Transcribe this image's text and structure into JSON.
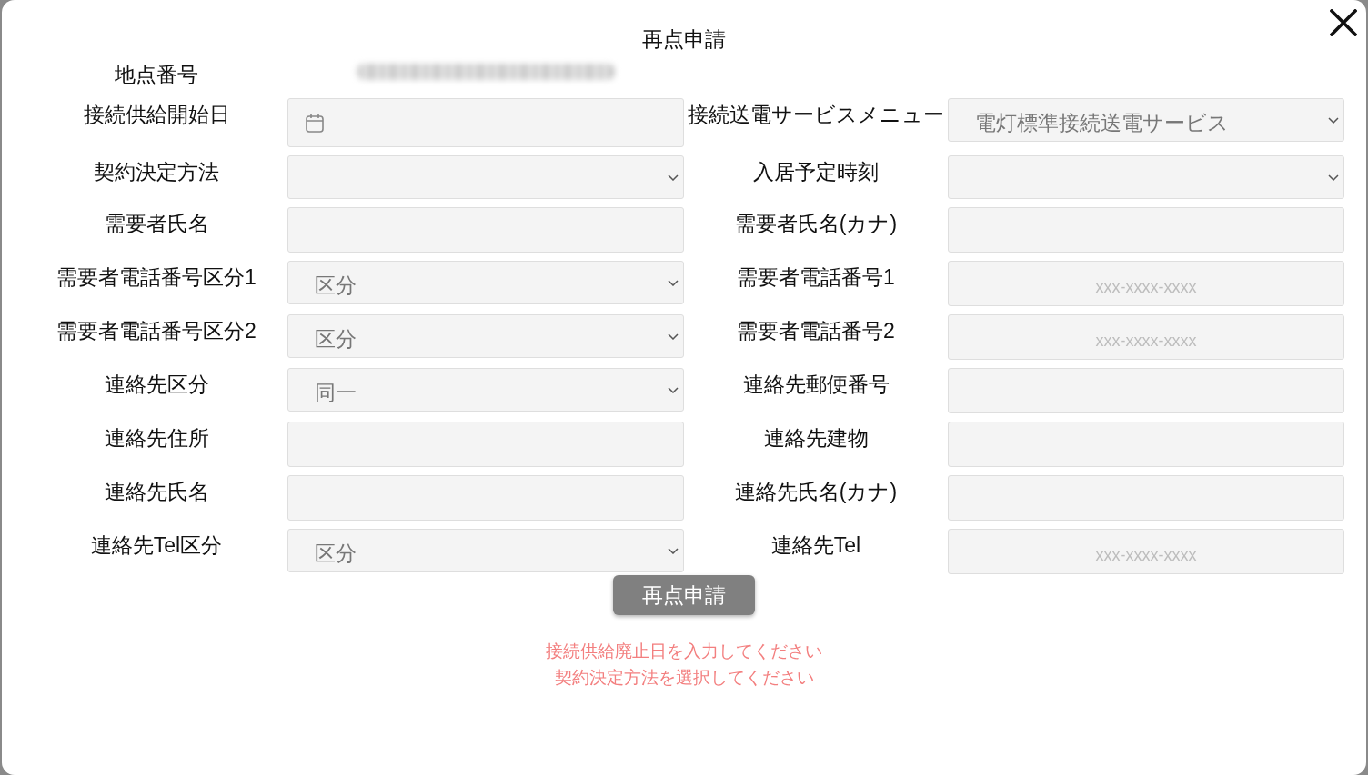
{
  "dialog": {
    "title": "再点申請"
  },
  "form": {
    "rows": [
      {
        "fields": [
          {
            "label": "地点番号",
            "kind": "redacted"
          }
        ]
      },
      {
        "fields": [
          {
            "label": "接続供給開始日",
            "kind": "date"
          },
          {
            "label": "接続送電サービスメニュー",
            "kind": "select",
            "value": "電灯標準接続送電サービス"
          }
        ]
      },
      {
        "fields": [
          {
            "label": "契約決定方法",
            "kind": "select"
          },
          {
            "label": "入居予定時刻",
            "kind": "select"
          }
        ]
      },
      {
        "fields": [
          {
            "label": "需要者氏名",
            "kind": "text"
          },
          {
            "label": "需要者氏名(カナ)",
            "kind": "text"
          }
        ]
      },
      {
        "fields": [
          {
            "label": "需要者電話番号区分1",
            "kind": "select",
            "value": "区分"
          },
          {
            "label": "需要者電話番号1",
            "kind": "text",
            "placeholder": "xxx-xxxx-xxxx"
          }
        ]
      },
      {
        "fields": [
          {
            "label": "需要者電話番号区分2",
            "kind": "select",
            "value": "区分"
          },
          {
            "label": "需要者電話番号2",
            "kind": "text",
            "placeholder": "xxx-xxxx-xxxx"
          }
        ]
      },
      {
        "fields": [
          {
            "label": "連絡先区分",
            "kind": "select",
            "value": "同一"
          },
          {
            "label": "連絡先郵便番号",
            "kind": "text"
          }
        ]
      },
      {
        "fields": [
          {
            "label": "連絡先住所",
            "kind": "text"
          },
          {
            "label": "連絡先建物",
            "kind": "text"
          }
        ]
      },
      {
        "fields": [
          {
            "label": "連絡先氏名",
            "kind": "text"
          },
          {
            "label": "連絡先氏名(カナ)",
            "kind": "text"
          }
        ]
      },
      {
        "fields": [
          {
            "label": "連絡先Tel区分",
            "kind": "select",
            "value": "区分"
          },
          {
            "label": "連絡先Tel",
            "kind": "text",
            "placeholder": "xxx-xxxx-xxxx"
          }
        ]
      }
    ]
  },
  "submit_button": {
    "label": "再点申請"
  },
  "errors": [
    "接続供給廃止日を入力してください",
    "契約決定方法を選択してください"
  ]
}
